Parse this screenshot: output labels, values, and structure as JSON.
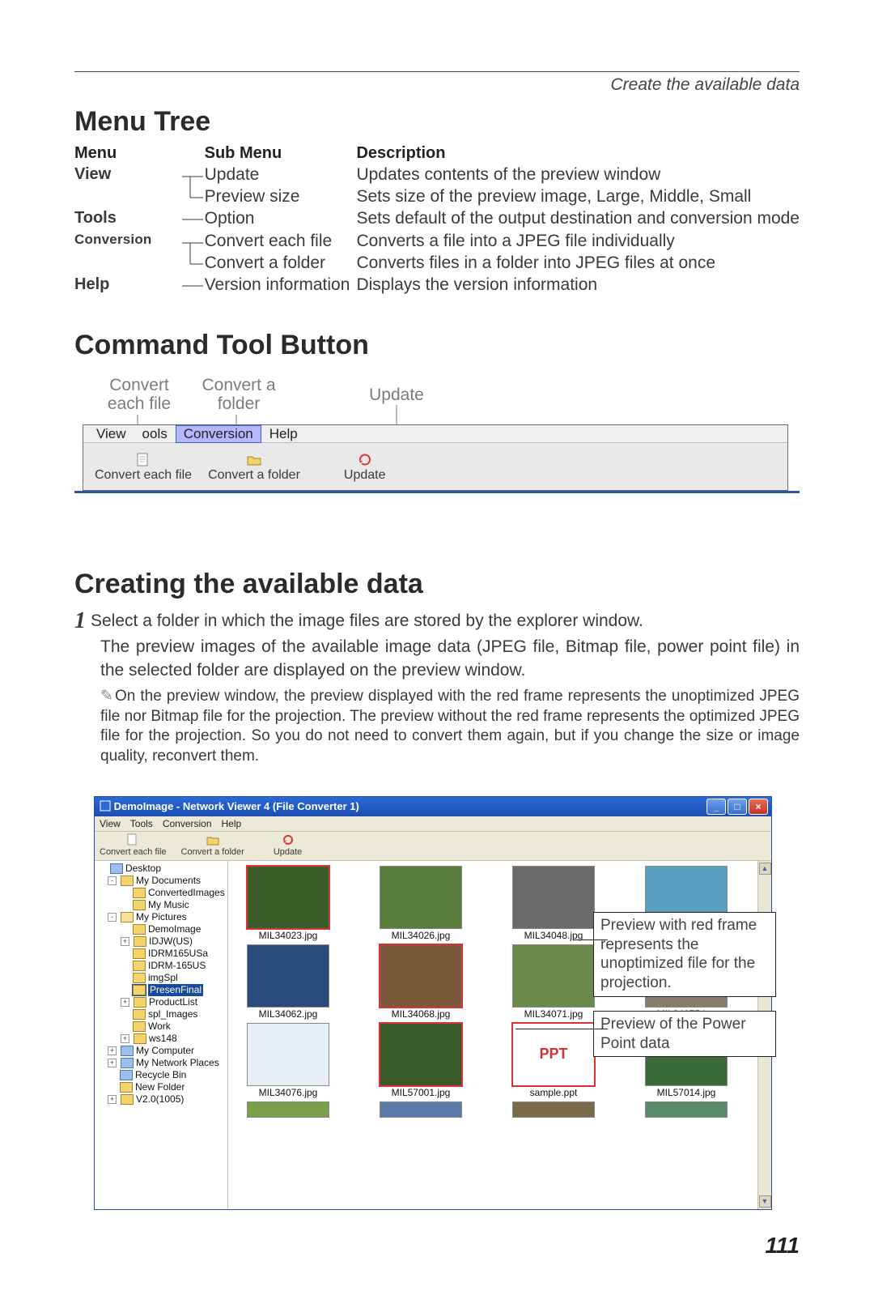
{
  "header": {
    "right": "Create the available data"
  },
  "menu_tree": {
    "title": "Menu Tree",
    "cols": {
      "menu": "Menu",
      "sub": "Sub Menu",
      "desc": "Description"
    },
    "rows": [
      {
        "menu": "View",
        "sub": "Update",
        "desc": "Updates contents of the preview window"
      },
      {
        "menu": "",
        "sub": "Preview size",
        "desc": "Sets size of the preview image, Large, Middle, Small"
      },
      {
        "menu": "Tools",
        "sub": "Option",
        "desc": "Sets default of the output destination and conversion mode"
      },
      {
        "menu": "Conversion",
        "sub": "Convert each file",
        "desc": "Converts a file into a JPEG file individually"
      },
      {
        "menu": "",
        "sub": "Convert a folder",
        "desc": "Converts files in a folder into JPEG files at once"
      },
      {
        "menu": "Help",
        "sub": "Version information",
        "desc": "Displays the version information"
      }
    ]
  },
  "command_tool": {
    "title": "Command Tool Button",
    "labels": {
      "convert_each": "Convert\neach file",
      "convert_folder": "Convert a\nfolder",
      "update": "Update"
    },
    "menubar": {
      "view": "View",
      "tools": "ools",
      "conversion": "Conversion",
      "help": "Help"
    },
    "buttons": {
      "convert_each": "Convert each file",
      "convert_folder": "Convert a folder",
      "update": "Update"
    }
  },
  "creating": {
    "title": "Creating the available data",
    "step_num": "1",
    "step_text": "Select a folder in which the image files are stored by the explorer window.",
    "step_sub": "The preview images of the available image data (JPEG file, Bitmap file, power point file) in the selected folder are displayed on the preview window.",
    "note_icon": "✎",
    "note": "On the preview window, the preview displayed with the red frame represents the unoptimized JPEG file nor Bitmap file for the projection. The preview without the red frame represents the optimized JPEG file for the projection. So you do not need to convert them again, but if you change the size or image quality, reconvert them."
  },
  "app": {
    "title": "DemoImage - Network Viewer 4 (File Converter 1)",
    "win": {
      "min": "_",
      "max": "□",
      "close": "×"
    },
    "menubar": [
      "View",
      "Tools",
      "Conversion",
      "Help"
    ],
    "toolbar": {
      "convert_each": "Convert each file",
      "convert_folder": "Convert a folder",
      "update": "Update"
    },
    "tree": [
      {
        "ind": 0,
        "exp": "",
        "icon": "sys",
        "label": "Desktop"
      },
      {
        "ind": 12,
        "exp": "-",
        "icon": "fld",
        "label": "My Documents"
      },
      {
        "ind": 28,
        "exp": "",
        "icon": "fld",
        "label": "ConvertedImages"
      },
      {
        "ind": 28,
        "exp": "",
        "icon": "fld",
        "label": "My Music"
      },
      {
        "ind": 12,
        "exp": "-",
        "icon": "open",
        "label": "My Pictures"
      },
      {
        "ind": 28,
        "exp": "",
        "icon": "fld",
        "label": "DemoImage"
      },
      {
        "ind": 28,
        "exp": "+",
        "icon": "fld",
        "label": "IDJW(US)"
      },
      {
        "ind": 28,
        "exp": "",
        "icon": "fld",
        "label": "IDRM165USa"
      },
      {
        "ind": 28,
        "exp": "",
        "icon": "fld",
        "label": "IDRM-165US"
      },
      {
        "ind": 28,
        "exp": "",
        "icon": "fld",
        "label": "imgSpl"
      },
      {
        "ind": 28,
        "exp": "",
        "icon": "fld",
        "label": "PresenFinal",
        "selected": true
      },
      {
        "ind": 28,
        "exp": "+",
        "icon": "fld",
        "label": "ProductList"
      },
      {
        "ind": 28,
        "exp": "",
        "icon": "fld",
        "label": "spl_Images"
      },
      {
        "ind": 28,
        "exp": "",
        "icon": "fld",
        "label": "Work"
      },
      {
        "ind": 28,
        "exp": "+",
        "icon": "fld",
        "label": "ws148"
      },
      {
        "ind": 12,
        "exp": "+",
        "icon": "sys",
        "label": "My Computer"
      },
      {
        "ind": 12,
        "exp": "+",
        "icon": "sys",
        "label": "My Network Places"
      },
      {
        "ind": 12,
        "exp": "",
        "icon": "sys",
        "label": "Recycle Bin"
      },
      {
        "ind": 12,
        "exp": "",
        "icon": "fld",
        "label": "New Folder"
      },
      {
        "ind": 12,
        "exp": "+",
        "icon": "fld",
        "label": "V2.0(1005)"
      }
    ],
    "thumbs": {
      "row1": [
        {
          "cap": "MIL34023.jpg",
          "red": true,
          "bg": "#3a5d2a"
        },
        {
          "cap": "MIL34026.jpg",
          "red": false,
          "bg": "#5a7c3a"
        },
        {
          "cap": "MIL34048.jpg",
          "red": false,
          "bg": "#6a6a6a"
        },
        {
          "cap": "",
          "red": false,
          "bg": "#5aa0c0"
        }
      ],
      "row2": [
        {
          "cap": "MIL34062.jpg",
          "red": false,
          "bg": "#294a7a"
        },
        {
          "cap": "MIL34068.jpg",
          "red": true,
          "bg": "#7a5a3a"
        },
        {
          "cap": "MIL34071.jpg",
          "red": false,
          "bg": "#6a8a4a"
        },
        {
          "cap": "MIL34075.jpg",
          "red": false,
          "bg": "#8a7a6a"
        }
      ],
      "row3": [
        {
          "cap": "MIL34076.jpg",
          "red": false,
          "bg": "#e8eef5"
        },
        {
          "cap": "MIL57001.jpg",
          "red": true,
          "bg": "#3a5a2a"
        },
        {
          "cap": "sample.ppt",
          "red": true,
          "ppt": true
        },
        {
          "cap": "MIL57014.jpg",
          "red": false,
          "bg": "#3a6a3a"
        }
      ],
      "row4": [
        {
          "cap": "",
          "red": false,
          "bg": "#7aa04a",
          "partial": true
        },
        {
          "cap": "",
          "red": false,
          "bg": "#5a7aaa",
          "partial": true
        },
        {
          "cap": "",
          "red": false,
          "bg": "#7a6a4a",
          "partial": true
        },
        {
          "cap": "",
          "red": false,
          "bg": "#5a8a6a",
          "partial": true
        }
      ]
    },
    "callouts": {
      "red": "Preview with red frame represents the unoptimized file for the projection.",
      "ppt": "Preview of the Power Point data"
    },
    "scroll": {
      "up": "▲",
      "down": "▼"
    }
  },
  "page_number": "111"
}
